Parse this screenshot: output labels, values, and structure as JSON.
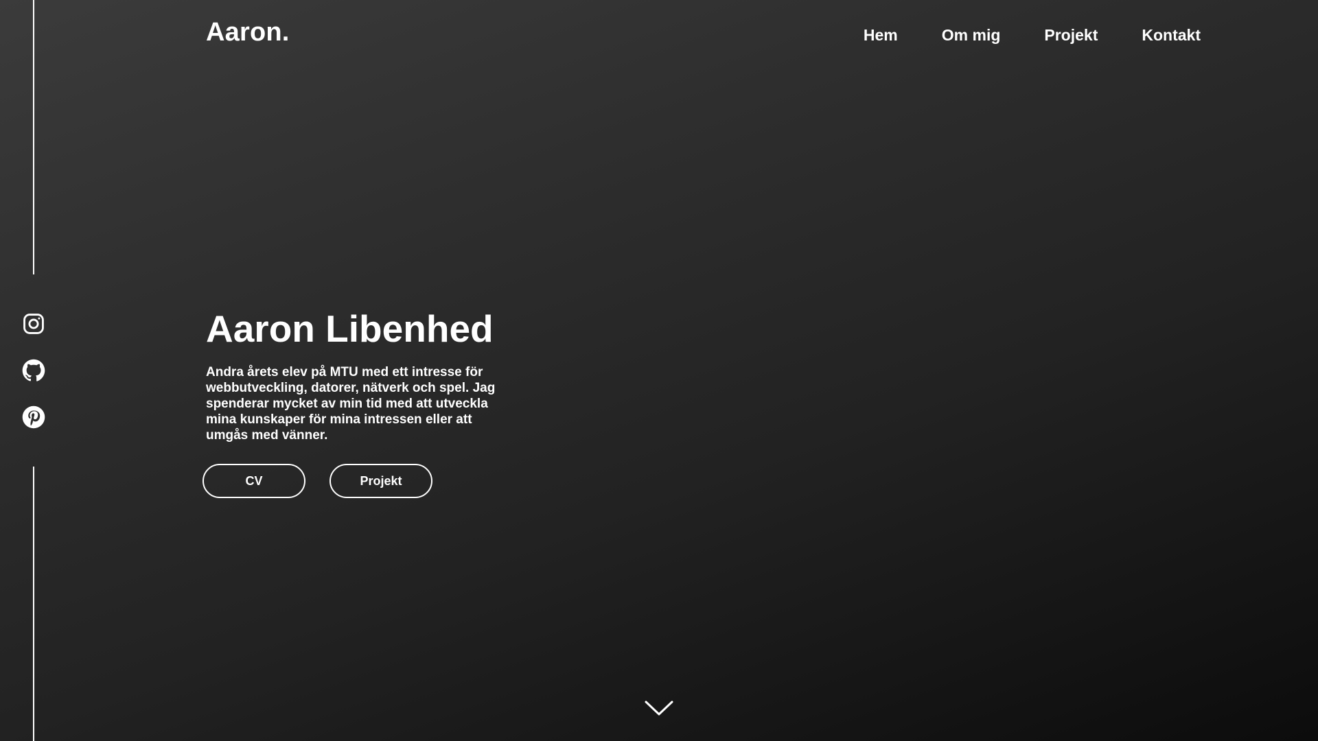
{
  "header": {
    "logo": "Aaron.",
    "nav": [
      {
        "label": "Hem"
      },
      {
        "label": "Om mig"
      },
      {
        "label": "Projekt"
      },
      {
        "label": "Kontakt"
      }
    ]
  },
  "socials": [
    {
      "icon": "instagram-icon"
    },
    {
      "icon": "github-icon"
    },
    {
      "icon": "pinterest-icon"
    }
  ],
  "hero": {
    "title": "Aaron Libenhed",
    "description": "Andra årets elev på MTU med ett intresse för webbutveckling, datorer, nätverk och spel. Jag spenderar mycket av min tid med att utveckla mina kunskaper för mina intressen eller att umgås med vänner.",
    "buttons": [
      {
        "label": "CV"
      },
      {
        "label": "Projekt"
      }
    ]
  },
  "scroll": {
    "icon": "chevron-down-icon"
  },
  "colors": {
    "text": "#ffffff",
    "background_start": "#3b3b3b",
    "background_end": "#0c0c0c"
  }
}
